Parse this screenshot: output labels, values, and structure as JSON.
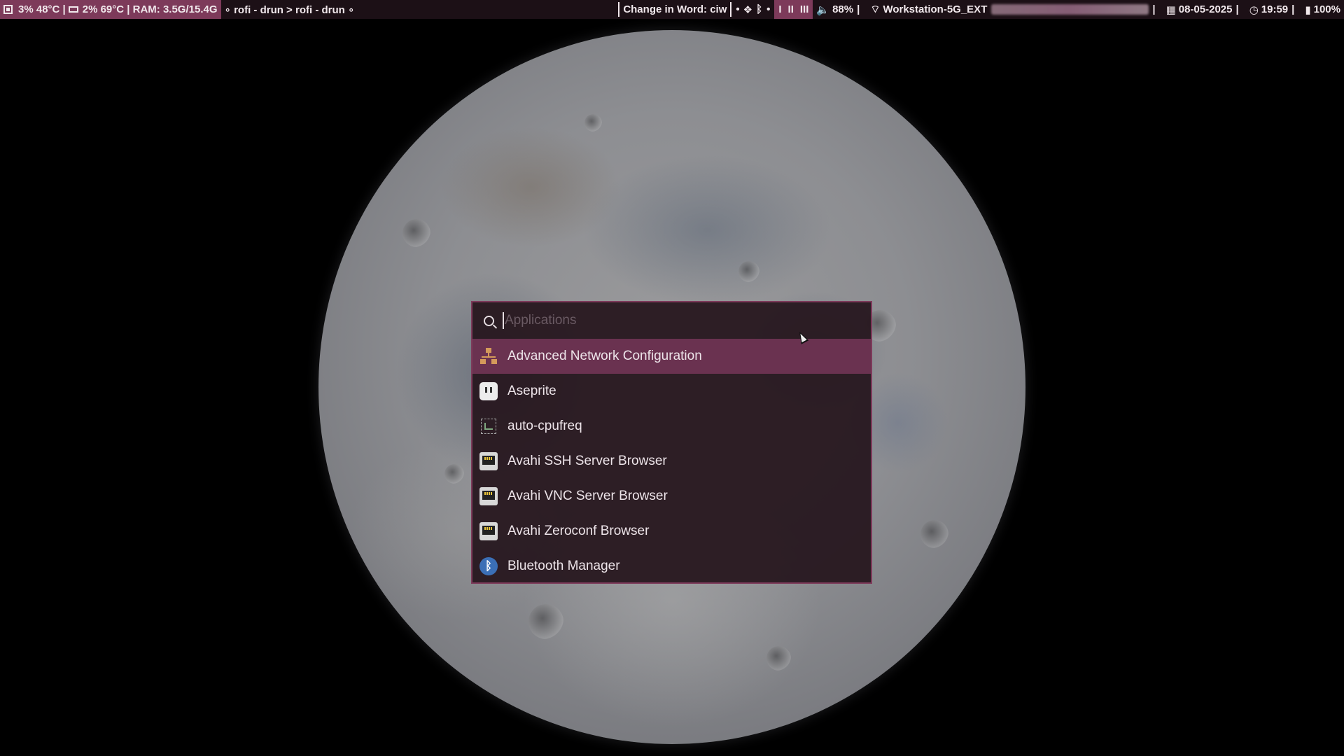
{
  "topbar": {
    "cpu_icon": "cpu-chip-icon",
    "cpu": "3% 48°C |",
    "gpu_icon": "gpu-card-icon",
    "gpu_ram": "2% 69°C | RAM: 3.5G/15.4G",
    "window_title": "∘ rofi - drun > rofi - drun ∘",
    "mode": "Change in Word: ciw",
    "tray_dot1": "•",
    "tray_dot2": "•",
    "workspaces": [
      "I",
      "II",
      "III"
    ],
    "volume": "88%",
    "wifi": "Workstation-5G_EXT",
    "date": "08-05-2025",
    "time": "19:59",
    "battery": "100%",
    "accent_color": "#7d3a5a"
  },
  "rofi": {
    "placeholder": "Applications",
    "items": [
      {
        "label": "Advanced Network Configuration",
        "icon": "network-topology-icon"
      },
      {
        "label": "Aseprite",
        "icon": "aseprite-icon"
      },
      {
        "label": "auto-cpufreq",
        "icon": "cpufreq-monitor-icon"
      },
      {
        "label": "Avahi SSH Server Browser",
        "icon": "ethernet-port-icon"
      },
      {
        "label": "Avahi VNC Server Browser",
        "icon": "ethernet-port-icon"
      },
      {
        "label": "Avahi Zeroconf Browser",
        "icon": "ethernet-port-icon"
      },
      {
        "label": "Bluetooth Manager",
        "icon": "bluetooth-icon"
      }
    ],
    "selected_index": 0
  }
}
